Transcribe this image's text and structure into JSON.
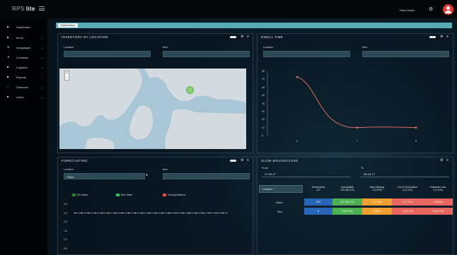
{
  "app": {
    "logo_prefix": "RPS",
    "logo_suffix": "lite",
    "greeting": "Hello Admin"
  },
  "sidebar": {
    "items": [
      {
        "label": "Dashboard",
        "icon": "dashboard-icon"
      },
      {
        "label": "Items",
        "icon": "items-icon"
      },
      {
        "label": "Languages",
        "icon": "languages-icon"
      },
      {
        "label": "Locations",
        "icon": "locations-icon"
      },
      {
        "label": "Logistics",
        "icon": "logistics-icon"
      },
      {
        "label": "Reports",
        "icon": "reports-icon"
      },
      {
        "label": "Scanners",
        "icon": "scanners-icon"
      },
      {
        "label": "Users",
        "icon": "users-icon"
      }
    ]
  },
  "breadcrumb": {
    "label": "Dashboard"
  },
  "inventory": {
    "title": "INVENTORY BY LOCATION",
    "location_label": "Location",
    "item_label": "Item",
    "location_value": "",
    "item_value": ""
  },
  "dwell": {
    "title": "DWELL TIME",
    "location_label": "Location",
    "item_label": "Item",
    "location_value": "",
    "item_value": ""
  },
  "chart_data": {
    "type": "line",
    "x": [
      "0",
      "7",
      "8"
    ],
    "values": [
      73,
      10,
      10
    ],
    "yticks": [
      "80",
      "70",
      "60",
      "50",
      "40",
      "30",
      "20",
      "10",
      "0"
    ],
    "ylim": [
      0,
      80
    ],
    "series_color": "#e8796a"
  },
  "forecasting": {
    "title": "FORECASTING",
    "location_label": "Location",
    "item_label": "Item",
    "location_value": "Store",
    "item_value": "",
    "legend": [
      {
        "label": "Min Value",
        "color": "#2f7d3a"
      },
      {
        "label": "Max Value",
        "color": "#3db36a"
      },
      {
        "label": "Closing Balance",
        "color": "#d9534f"
      }
    ],
    "yticks": [
      "3.0",
      "2.5",
      "2.0",
      "1.5",
      "1.0",
      "0.5",
      "0.0"
    ]
  },
  "slow_moving": {
    "title": "SLOW MOVING/LOSS",
    "from_label": "From",
    "to_label": "To",
    "from_value": "07-09-17",
    "to_value": "08-03-17",
    "location_header": "Location",
    "columns": [
      {
        "name": "Movements",
        "sub": "127"
      },
      {
        "name": "Acceptable",
        "sub": "122 (96.1%)"
      },
      {
        "name": "Slow Moving",
        "sub": "2 (1.6%)"
      },
      {
        "name": "Out of Circulation",
        "sub": "3 (2.4%)"
      },
      {
        "name": "Potential Loss",
        "sub": "2 (1.6%)"
      }
    ],
    "rows": [
      {
        "location": "Store",
        "cells": [
          "121",
          "117 (96.7%)",
          "2 (1.7%)",
          "2 (1.7%)",
          "1 (0.8%)"
        ]
      },
      {
        "location": "Zinc",
        "cells": [
          "6",
          "5 (83.3%)",
          "0 (0%)",
          "1 (16.7%)",
          "1 (16.7%)"
        ]
      }
    ],
    "colors": {
      "movements": "#2a66b8",
      "acceptable": "#4caf50",
      "slow": "#f0a030",
      "out": "#e8665f",
      "loss": "#e8665f"
    }
  }
}
